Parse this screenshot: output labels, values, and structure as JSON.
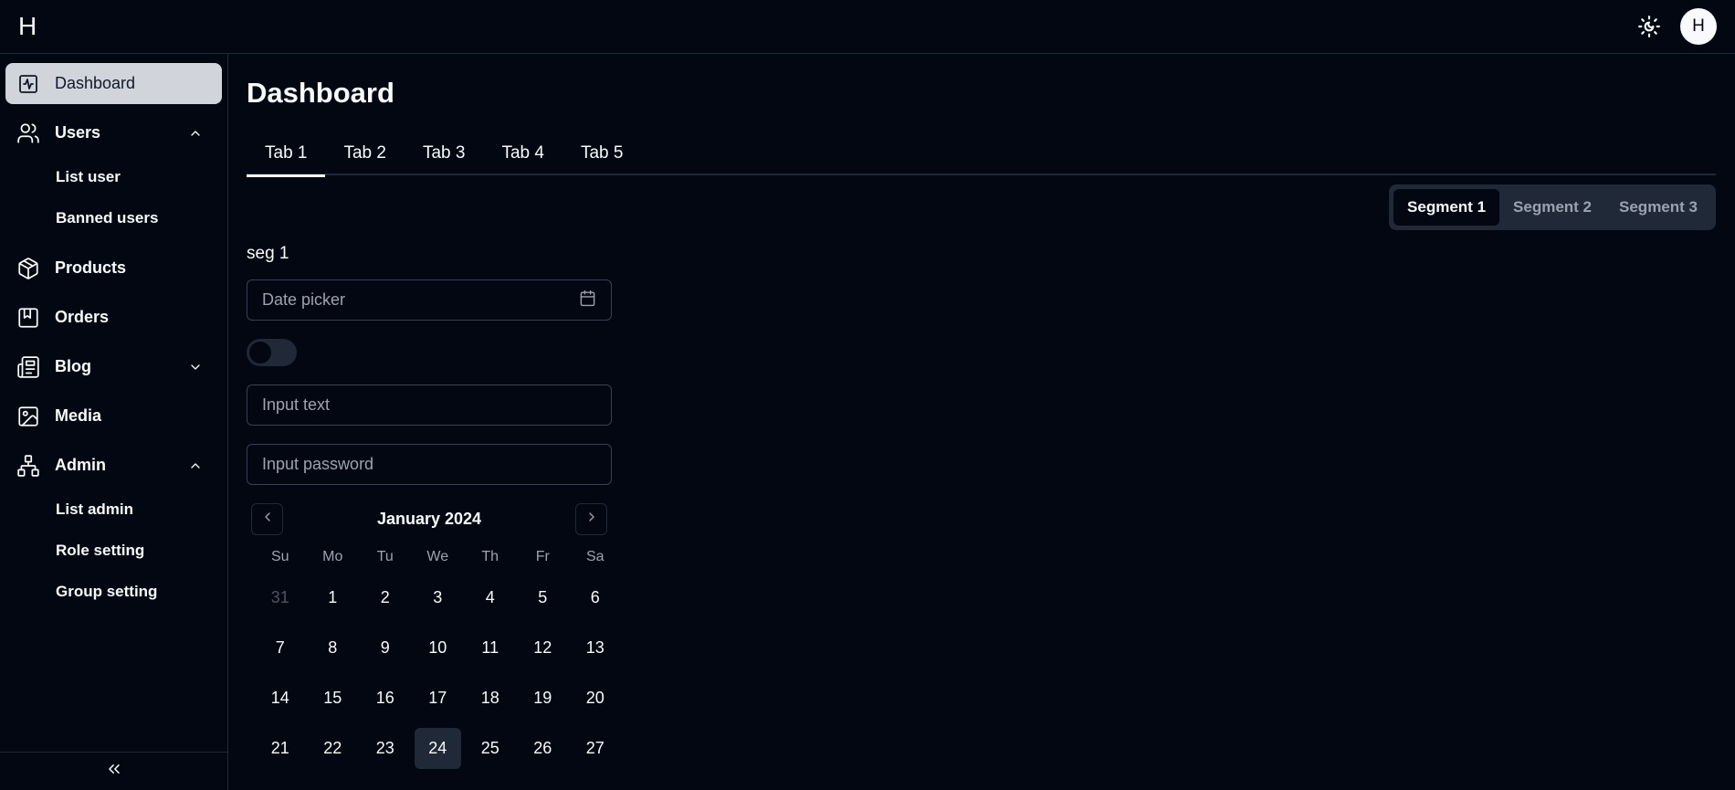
{
  "header": {
    "logo": "H",
    "avatar": "H"
  },
  "sidebar": {
    "items": [
      {
        "label": "Dashboard",
        "icon": "activity-icon",
        "active": true
      },
      {
        "label": "Users",
        "icon": "users-icon",
        "expanded": true,
        "children": [
          "List user",
          "Banned users"
        ]
      },
      {
        "label": "Products",
        "icon": "box-icon"
      },
      {
        "label": "Orders",
        "icon": "bookmark-icon"
      },
      {
        "label": "Blog",
        "icon": "newspaper-icon",
        "expanded": false
      },
      {
        "label": "Media",
        "icon": "image-icon"
      },
      {
        "label": "Admin",
        "icon": "sitemap-icon",
        "expanded": true,
        "children": [
          "List admin",
          "Role setting",
          "Group setting"
        ]
      }
    ],
    "collapse_icon": "chevrons-left-icon"
  },
  "main": {
    "title": "Dashboard",
    "tabs": [
      "Tab 1",
      "Tab 2",
      "Tab 3",
      "Tab 4",
      "Tab 5"
    ],
    "active_tab": 0,
    "segments": [
      "Segment 1",
      "Segment 2",
      "Segment 3"
    ],
    "active_segment": 0,
    "segment_content": "seg 1",
    "date_picker": {
      "placeholder": "Date picker",
      "value": ""
    },
    "toggle": {
      "on": false
    },
    "input_text": {
      "placeholder": "Input text",
      "value": ""
    },
    "input_password": {
      "placeholder": "Input password",
      "value": ""
    },
    "calendar": {
      "title": "January 2024",
      "weekdays": [
        "Su",
        "Mo",
        "Tu",
        "We",
        "Th",
        "Fr",
        "Sa"
      ],
      "days": [
        "31",
        "1",
        "2",
        "3",
        "4",
        "5",
        "6",
        "7",
        "8",
        "9",
        "10",
        "11",
        "12",
        "13",
        "14",
        "15",
        "16",
        "17",
        "18",
        "19",
        "20",
        "21",
        "22",
        "23",
        "24",
        "25",
        "26",
        "27"
      ],
      "outside_days": [
        "31"
      ],
      "selected": "24"
    }
  },
  "colors": {
    "background": "#030712",
    "foreground": "#f9fafb",
    "border": "#1f2937",
    "muted": "#9ca3af",
    "active_nav_bg": "#d1d5db"
  }
}
